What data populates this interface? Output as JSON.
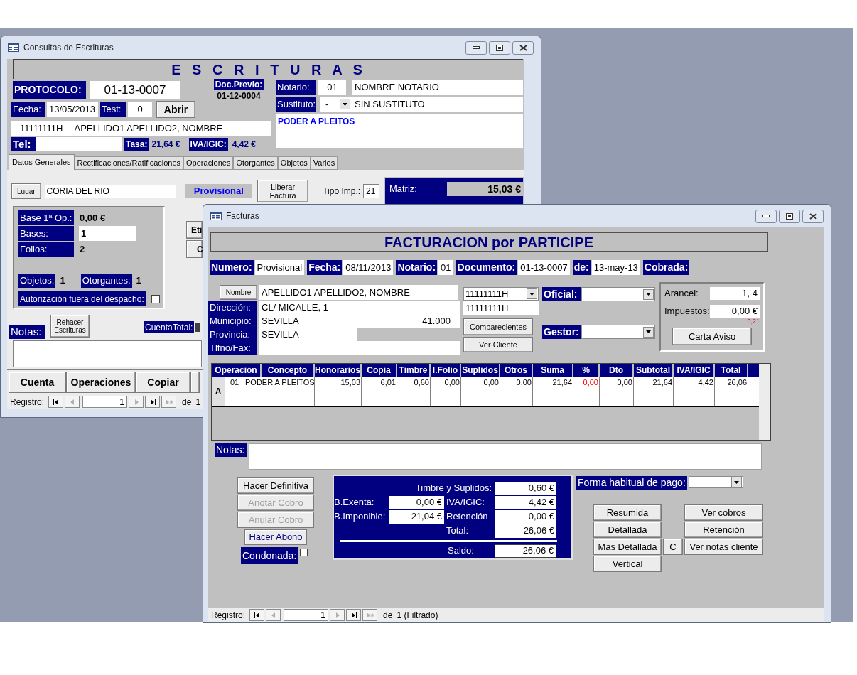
{
  "back_window": {
    "title": "Consultas de Escrituras",
    "heading": "E S C R I T U R A S",
    "protocolo": {
      "label": "PROTOCOLO:",
      "value": "01-13-0007"
    },
    "doc_previo": {
      "label": "Doc.Previo:",
      "value": "01-12-0004"
    },
    "fecha": {
      "label": "Fecha:",
      "value": "13/05/2013"
    },
    "test": {
      "label": "Test:",
      "value": "0"
    },
    "abrir_button": "Abrir",
    "client": {
      "id": "11111111H",
      "name": "APELLIDO1 APELLIDO2, NOMBRE"
    },
    "tel": {
      "label": "Tel:"
    },
    "tasa": {
      "label": "Tasa:",
      "value": "21,64 €"
    },
    "iva": {
      "label": "IVA/IGIC:",
      "value": "4,42 €"
    },
    "notario": {
      "label": "Notario:",
      "code": "01",
      "name": "NOMBRE NOTARIO"
    },
    "sustituto": {
      "label": "Sustituto:",
      "code": "-",
      "name": "SIN SUSTITUTO"
    },
    "concepto": "PODER A PLEITOS",
    "tabs": [
      {
        "label": "Datos Generales",
        "selected": true
      },
      {
        "label": "Rectificaciones/Ratificaciones",
        "selected": false
      },
      {
        "label": "Operaciones",
        "selected": false
      },
      {
        "label": "Otorgantes",
        "selected": false
      },
      {
        "label": "Objetos",
        "selected": false
      },
      {
        "label": "Varios",
        "selected": false
      }
    ],
    "lugar": {
      "button": "Lugar",
      "value": "CORIA DEL RIO"
    },
    "estado": "Provisional",
    "liberar_button": "Liberar Factura",
    "tipo_imp": {
      "label": "Tipo Imp.:",
      "value": "21"
    },
    "matriz": {
      "label": "Matriz:",
      "value": "15,03 €"
    },
    "stats": [
      {
        "label": "Base 1ª Op.:",
        "value": "0,00 €",
        "kind": "text"
      },
      {
        "label": "Bases:",
        "value": "1",
        "kind": "field"
      },
      {
        "label": "Folios:",
        "value": "2",
        "kind": "text"
      }
    ],
    "counts": [
      {
        "label": "Objetos:",
        "value": "1"
      },
      {
        "label": "Otorgantes:",
        "value": "1"
      }
    ],
    "autorizacion": {
      "label": "Autorización fuera del despacho:",
      "checked": false
    },
    "side_buttons": [
      "Eti",
      "C"
    ],
    "notas_label": "Notas:",
    "rehacer_button": "Rehacer Escrituras",
    "cuenta_total": {
      "label": "CuentaTotal:",
      "checked": true
    },
    "bottom_buttons": [
      "Cuenta",
      "Operaciones",
      "Copiar"
    ],
    "registro": {
      "label": "Registro:",
      "value": "1",
      "of": "de",
      "count": "1",
      "nav": [
        {
          "kind": "first",
          "disabled": false
        },
        {
          "kind": "prev",
          "disabled": true
        },
        {
          "kind": "next",
          "disabled": true
        },
        {
          "kind": "last",
          "disabled": false
        },
        {
          "kind": "new",
          "disabled": true
        }
      ]
    }
  },
  "front_window": {
    "title": "Facturas",
    "heading": "FACTURACION por PARTICIPE",
    "header_fields": [
      {
        "label": "Numero:",
        "value": "Provisional"
      },
      {
        "label": "Fecha:",
        "value": "08/11/2013"
      },
      {
        "label": "Notario:",
        "value": "01"
      },
      {
        "label": "Documento:",
        "value": "01-13-0007"
      },
      {
        "label": "de:",
        "value": "13-may-13"
      },
      {
        "label": "Cobrada:"
      }
    ],
    "nombre_button": "Nombre",
    "client_name": "APELLIDO1 APELLIDO2, NOMBRE",
    "address": [
      {
        "label": "Dirección:",
        "value": "CL/ MICALLE, 1"
      },
      {
        "label": "Municipio:",
        "value": "SEVILLA",
        "postal": "41.000"
      },
      {
        "label": "Provincia:",
        "value": "SEVILLA"
      },
      {
        "label": "Tlfno/Fax:"
      }
    ],
    "nif_select": "11111111H",
    "nif": "11111111H",
    "client_buttons": [
      "Comparecientes",
      "Ver Cliente"
    ],
    "oficial": {
      "label": "Oficial:"
    },
    "gestor": {
      "label": "Gestor:"
    },
    "arancel": {
      "label": "Arancel:",
      "value": "1, 4"
    },
    "impuestos": {
      "label": "Impuestos:",
      "value": "0,00 €",
      "note": "0,21"
    },
    "carta_button": "Carta Aviso",
    "table": {
      "columns": [
        {
          "label": "Operación",
          "kind": "code"
        },
        {
          "label": "Concepto",
          "kind": "text"
        },
        {
          "label": "Honorarios",
          "kind": "number"
        },
        {
          "label": "Copia",
          "kind": "number"
        },
        {
          "label": "Timbre",
          "kind": "number"
        },
        {
          "label": "I.Folio",
          "kind": "number"
        },
        {
          "label": "Suplidos",
          "kind": "number"
        },
        {
          "label": "Otros",
          "kind": "number"
        },
        {
          "label": "Suma",
          "kind": "number"
        },
        {
          "label": "%",
          "kind": "percent"
        },
        {
          "label": "Dto",
          "kind": "number"
        },
        {
          "label": "Subtotal",
          "kind": "number"
        },
        {
          "label": "IVA/IGIC",
          "kind": "number"
        },
        {
          "label": "Total",
          "kind": "number"
        }
      ],
      "rows": [
        {
          "selector": "A",
          "cells": [
            "01",
            "PODER A PLEITOS",
            "15,03",
            "6,01",
            "0,60",
            "0,00",
            "0,00",
            "0,00",
            "21,64",
            "0,00",
            "0,00",
            "21,64",
            "4,42",
            "26,06"
          ]
        }
      ]
    },
    "notas_label": "Notas:",
    "action_buttons": [
      {
        "label": "Hacer Definitiva",
        "disabled": false,
        "kind": "plain"
      },
      {
        "label": "Anotar Cobro",
        "disabled": true,
        "kind": "plain"
      },
      {
        "label": "Anular Cobro",
        "disabled": true,
        "kind": "plain"
      },
      {
        "label": "Hacer Abono",
        "disabled": false,
        "kind": "accent"
      }
    ],
    "condonada": {
      "label": "Condonada:",
      "checked": false
    },
    "totals": {
      "lines": [
        {
          "label": "Timbre y Suplidos:",
          "value": "0,60 €"
        },
        {
          "label": "IVA/IGIC:",
          "value": "4,42 €"
        },
        {
          "label": "Retención",
          "value": "0,00 €"
        },
        {
          "label": "Total:",
          "value": "26,06 €"
        }
      ],
      "bases": [
        {
          "label": "B.Exenta:",
          "value": "0,00 €"
        },
        {
          "label": "B.Imponible:",
          "value": "21,04 €"
        }
      ],
      "saldo": {
        "label": "Saldo:",
        "value": "26,06 €"
      }
    },
    "forma_pago": {
      "label": "Forma habitual de pago:"
    },
    "report_buttons": [
      "Resumida",
      "Detallada",
      "Mas Detallada",
      "Vertical"
    ],
    "c_button": "C",
    "side_buttons": [
      "Ver cobros",
      "Retención",
      "Ver notas cliente"
    ],
    "registro": {
      "label": "Registro:",
      "value": "1",
      "of": "de",
      "count": "1 (Filtrado)",
      "nav": [
        {
          "kind": "first",
          "disabled": false
        },
        {
          "kind": "prev",
          "disabled": true
        },
        {
          "kind": "next",
          "disabled": true
        },
        {
          "kind": "last",
          "disabled": false
        },
        {
          "kind": "new",
          "disabled": true
        }
      ]
    }
  }
}
